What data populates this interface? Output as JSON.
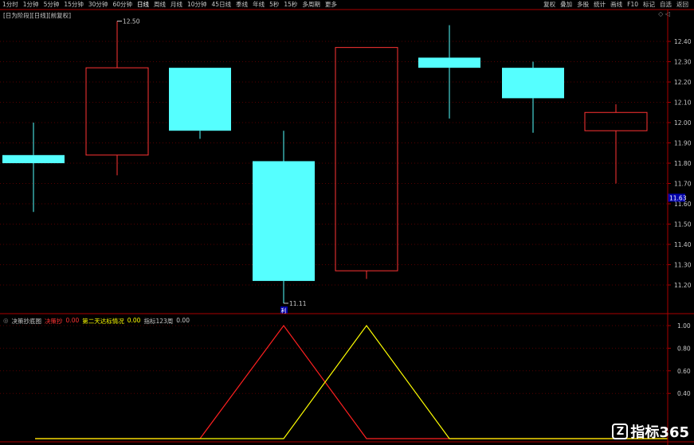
{
  "toolbar": {
    "periods": [
      "1分时",
      "1分钟",
      "5分钟",
      "15分钟",
      "30分钟",
      "60分钟",
      "日线",
      "周线",
      "月线",
      "10分钟",
      "45日线",
      "季线",
      "年线",
      "5秒",
      "15秒",
      "多周期",
      "更多"
    ],
    "active_period": "日线",
    "right_items": [
      "复权",
      "叠加",
      "多股",
      "统计",
      "画线",
      "F10",
      "标记",
      "自选",
      "返回"
    ]
  },
  "main_panel": {
    "label": "[日为阶段][日线][前复权]",
    "controls": "◇ ◁"
  },
  "sub_panel": {
    "title": "决策抄底图",
    "items": [
      {
        "text": "决策抄",
        "color": "#ff3333"
      },
      {
        "text": "0.00",
        "color": "#ff3333"
      },
      {
        "text": "第二天达标情况",
        "color": "#ffff00"
      },
      {
        "text": "0.00",
        "color": "#ffff00"
      },
      {
        "text": "指标123周",
        "color": "#c8c8c8"
      },
      {
        "text": "0.00",
        "color": "#c8c8c8"
      }
    ]
  },
  "logo": {
    "text": "指标365",
    "badge": "Z"
  },
  "colors": {
    "up": "#ff3333",
    "down": "#55ffff",
    "axis": "#aa0000",
    "grid": "#550000",
    "line_red": "#ff2020",
    "line_yellow": "#ffff00",
    "current_price_bg": "#0000aa"
  },
  "chart_data": [
    {
      "type": "candlestick",
      "ylim": [
        11.1,
        12.5
      ],
      "y_ticks": [
        11.2,
        11.3,
        11.4,
        11.5,
        11.6,
        11.7,
        11.8,
        11.9,
        12.0,
        12.1,
        12.2,
        12.3,
        12.4
      ],
      "y_tick_labels": [
        "11.20",
        "11.30",
        "11.40",
        "11.50",
        "11.60",
        "11.70",
        "11.80",
        "11.90",
        "12.00",
        "12.10",
        "12.20",
        "12.30",
        "12.40"
      ],
      "current_price": 11.63,
      "current_price_label": "11.63",
      "annotations": [
        {
          "label": "12.50",
          "value": 12.5,
          "candle": 1
        },
        {
          "label": "11.11",
          "value": 11.11,
          "candle": 3
        }
      ],
      "marker": {
        "label": "利",
        "candle": 3
      },
      "candles": [
        {
          "open": 11.84,
          "close": 11.8,
          "high": 12.0,
          "low": 11.56
        },
        {
          "open": 11.84,
          "close": 12.27,
          "high": 12.5,
          "low": 11.74
        },
        {
          "open": 12.27,
          "close": 11.96,
          "high": 12.27,
          "low": 11.92
        },
        {
          "open": 11.81,
          "close": 11.22,
          "high": 11.96,
          "low": 11.11
        },
        {
          "open": 11.27,
          "close": 12.37,
          "high": 12.37,
          "low": 11.23
        },
        {
          "open": 12.32,
          "close": 12.27,
          "high": 12.48,
          "low": 12.02
        },
        {
          "open": 12.27,
          "close": 12.12,
          "high": 12.3,
          "low": 11.95
        },
        {
          "open": 11.96,
          "close": 12.05,
          "high": 12.09,
          "low": 11.7
        }
      ]
    },
    {
      "type": "line",
      "ylim": [
        0,
        1.05
      ],
      "y_ticks": [
        0.4,
        0.6,
        0.8,
        1.0
      ],
      "y_tick_labels": [
        "0.40",
        "0.60",
        "0.80",
        "1.00"
      ],
      "x_positions": [
        0,
        1,
        2,
        3,
        4,
        5,
        6,
        7
      ],
      "series": [
        {
          "color": "#ff2020",
          "values": [
            0,
            0,
            0,
            1.0,
            0,
            0,
            0,
            0
          ]
        },
        {
          "color": "#ffff00",
          "values": [
            0,
            0,
            0,
            0,
            1.0,
            0,
            0,
            0
          ]
        }
      ]
    }
  ]
}
